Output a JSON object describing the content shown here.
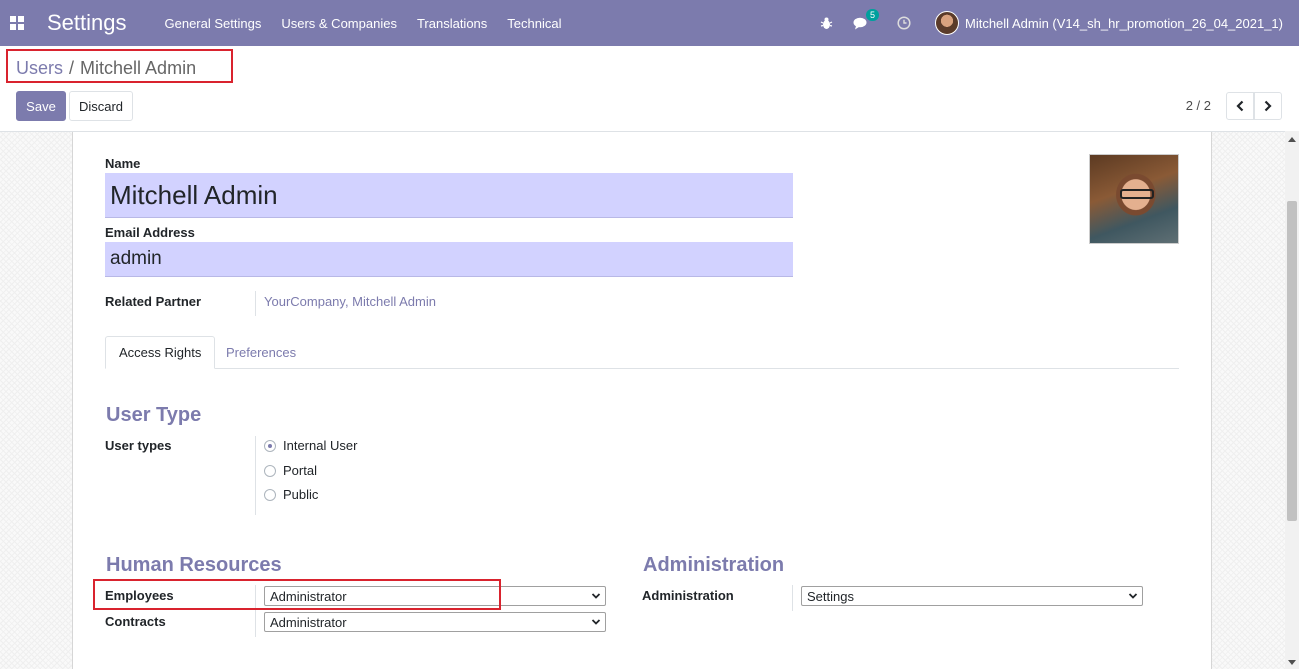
{
  "navbar": {
    "app_title": "Settings",
    "menu": [
      "General Settings",
      "Users & Companies",
      "Translations",
      "Technical"
    ],
    "messages_badge": "5",
    "user_label": "Mitchell Admin (V14_sh_hr_promotion_26_04_2021_1)"
  },
  "breadcrumb": {
    "parent": "Users",
    "separator": "/",
    "current": "Mitchell Admin"
  },
  "toolbar": {
    "save_label": "Save",
    "discard_label": "Discard"
  },
  "pager": {
    "text": "2 / 2"
  },
  "form": {
    "name_label": "Name",
    "name_value": "Mitchell Admin",
    "email_label": "Email Address",
    "email_value": "admin",
    "related_partner_label": "Related Partner",
    "related_partner_value": "YourCompany, Mitchell Admin"
  },
  "tabs": [
    {
      "label": "Access Rights",
      "active": true
    },
    {
      "label": "Preferences",
      "active": false
    }
  ],
  "user_type": {
    "title": "User Type",
    "label": "User types",
    "options": [
      {
        "label": "Internal User",
        "checked": true
      },
      {
        "label": "Portal",
        "checked": false
      },
      {
        "label": "Public",
        "checked": false
      }
    ]
  },
  "human_resources": {
    "title": "Human Resources",
    "employees_label": "Employees",
    "employees_value": "Administrator",
    "contracts_label": "Contracts",
    "contracts_value": "Administrator"
  },
  "administration": {
    "title": "Administration",
    "label": "Administration",
    "value": "Settings"
  },
  "colors": {
    "brand": "#7c7bad",
    "highlight_box": "#d9232e",
    "required_field": "#d2d2ff"
  }
}
